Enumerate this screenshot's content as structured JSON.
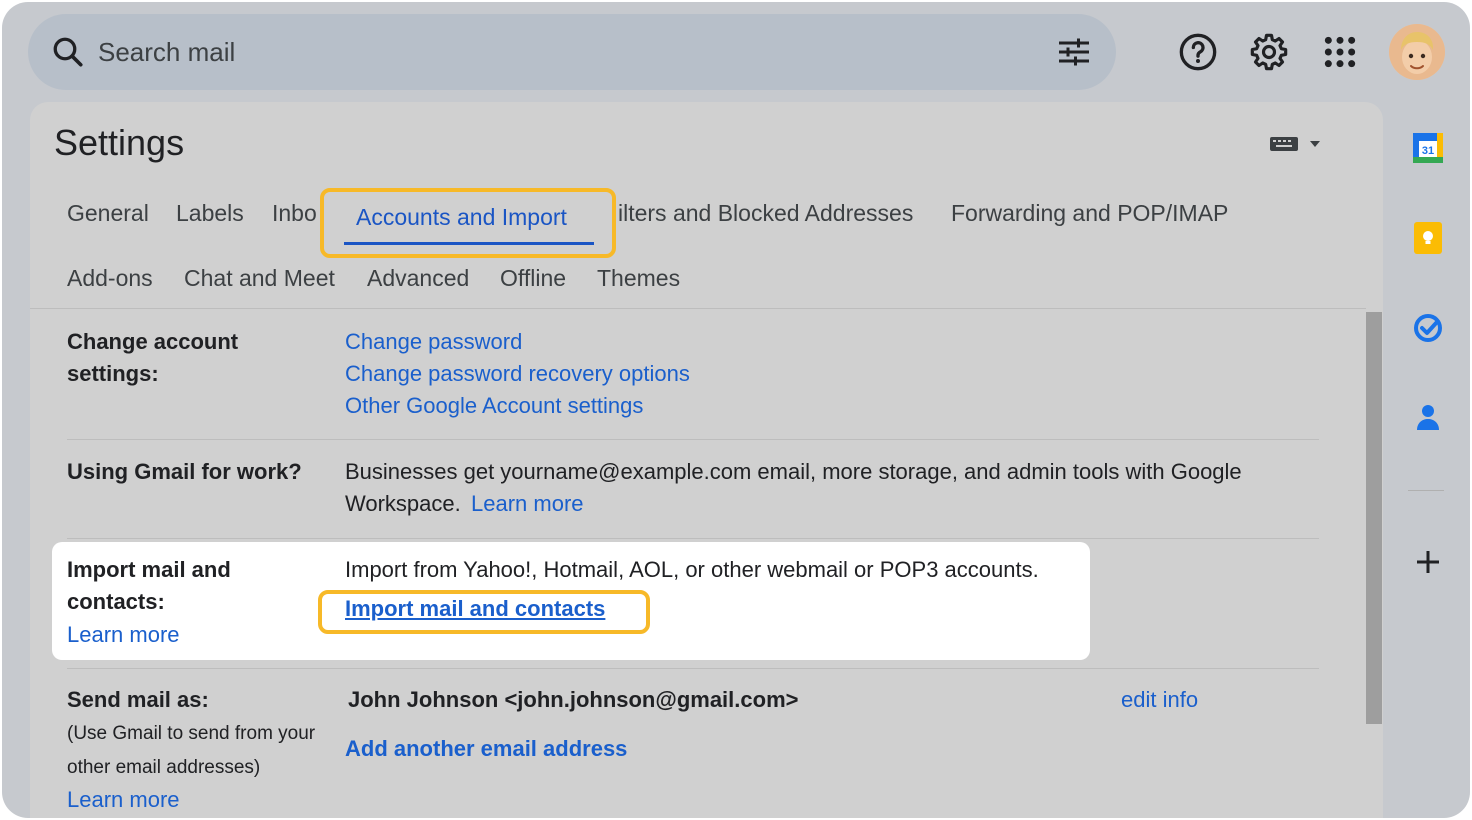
{
  "search": {
    "placeholder": "Search mail",
    "icon": "search-icon",
    "options_icon": "tune-icon"
  },
  "header_icons": [
    "help-icon",
    "gear-icon",
    "apps-grid-icon",
    "avatar"
  ],
  "settings": {
    "title": "Settings",
    "tabs_row1": [
      "General",
      "Labels",
      "Inbo",
      "Accounts and Import",
      "ilters and Blocked Addresses",
      "Forwarding and POP/IMAP"
    ],
    "tabs_row2": [
      "Add-ons",
      "Chat and Meet",
      "Advanced",
      "Offline",
      "Themes"
    ],
    "active_tab": "Accounts and Import"
  },
  "sections": {
    "change_account": {
      "label_line1": "Change account",
      "label_line2": "settings:",
      "links": [
        "Change password",
        "Change password recovery options",
        "Other Google Account settings"
      ]
    },
    "gmail_work": {
      "label": "Using Gmail for work?",
      "text_line1": "Businesses get yourname@example.com email, more storage, and admin tools with Google",
      "text_line2": "Workspace.",
      "learn_more": "Learn more"
    },
    "import": {
      "label_line1": "Import mail and",
      "label_line2": "contacts:",
      "learn_more": "Learn more",
      "text": "Import from Yahoo!, Hotmail, AOL, or other webmail or POP3 accounts.",
      "action": "Import mail and contacts"
    },
    "send_as": {
      "label": "Send mail as:",
      "note_line1": "(Use Gmail to send from your",
      "note_line2": "other email addresses)",
      "learn_more": "Learn more",
      "identity": "John Johnson <john.johnson@gmail.com>",
      "edit": "edit info",
      "add": "Add another email address"
    }
  },
  "colors": {
    "accent": "#f7b928",
    "link": "#1a5fcc",
    "background": "#c6c9ce"
  },
  "side_rail": {
    "calendar_date": "31",
    "icons": [
      "calendar-icon",
      "keep-icon",
      "tasks-icon",
      "contacts-icon",
      "plus-icon"
    ]
  }
}
